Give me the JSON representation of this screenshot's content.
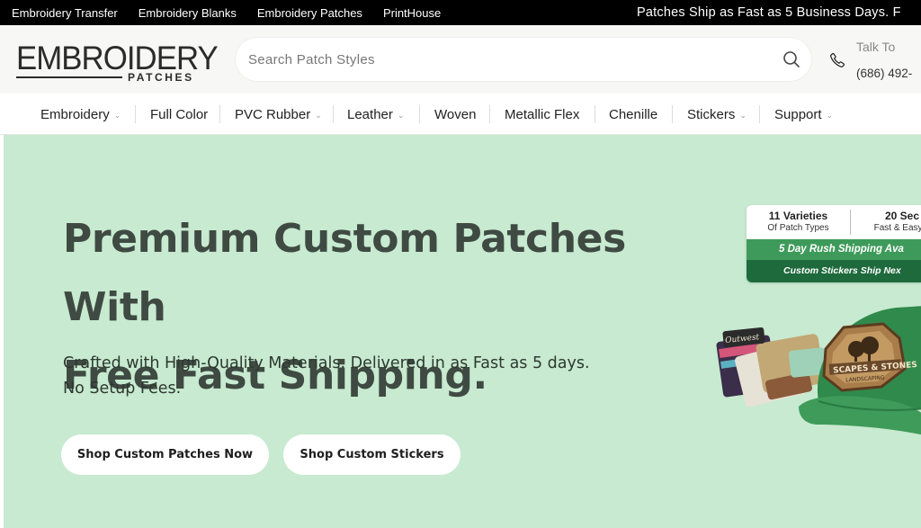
{
  "topbar": {
    "links": [
      "Embroidery Transfer",
      "Embroidery Blanks",
      "Embroidery Patches",
      "PrintHouse"
    ],
    "promo": "Patches Ship as Fast as 5 Business Days. F"
  },
  "header": {
    "logo": {
      "main": "EMBROIDERY",
      "sub": "PATCHES"
    },
    "search_placeholder": "Search Patch Styles",
    "talk_label": "Talk To",
    "phone": "(686) 492-"
  },
  "nav": {
    "items": [
      {
        "label": "Embroidery",
        "dropdown": true
      },
      {
        "label": "Full Color",
        "dropdown": false
      },
      {
        "label": "PVC Rubber",
        "dropdown": true
      },
      {
        "label": "Leather",
        "dropdown": true
      },
      {
        "label": "Woven",
        "dropdown": false
      },
      {
        "label": "Metallic Flex",
        "dropdown": false
      },
      {
        "label": "Chenille",
        "dropdown": false
      },
      {
        "label": "Stickers",
        "dropdown": true
      },
      {
        "label": "Support",
        "dropdown": true
      }
    ]
  },
  "hero": {
    "title_line1": "Premium Custom Patches With",
    "title_line2": "Free Fast Shipping.",
    "sub_line1": "Crafted with High-Quality Materials. Delivered in as Fast as 5 days.",
    "sub_line2": "No Setup Fees.",
    "btn_patches": "Shop Custom Patches Now",
    "btn_stickers": "Shop Custom Stickers",
    "badge": {
      "col1_title": "11 Varieties",
      "col1_sub": "Of Patch Types",
      "col2_title": "20 Sec",
      "col2_sub": "Fast & Easy A",
      "row2": "5 Day Rush Shipping Ava",
      "row3": "Custom Stickers Ship Nex"
    },
    "art": {
      "patch_text": "SCAPES & STONES",
      "patch_sub": "LANDSCAPING"
    }
  },
  "colors": {
    "topbar_bg": "#000000",
    "header_bg": "#f7f7f5",
    "hero_bg": "#c7ead0",
    "hero_text": "#3f4a43",
    "badge_green": "#3e9a5a",
    "badge_dark_green": "#1e6a3c",
    "cap_green": "#2f8a4c"
  },
  "icons": {
    "search": "search-icon",
    "phone": "phone-icon",
    "chevron": "chevron-down-icon"
  }
}
